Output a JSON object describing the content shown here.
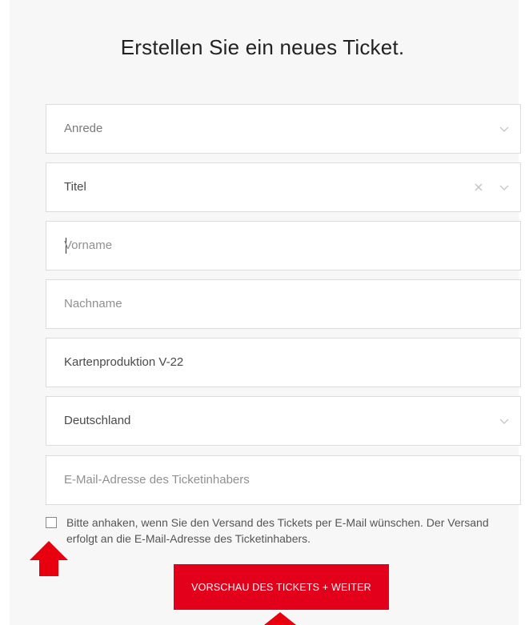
{
  "form": {
    "title": "Erstellen Sie ein neues Ticket.",
    "salutation": {
      "placeholder": "Anrede"
    },
    "academic_title": {
      "value": "Titel"
    },
    "first_name": {
      "placeholder": "Vorname"
    },
    "last_name": {
      "placeholder": "Nachname"
    },
    "card_production": {
      "value": "Kartenproduktion V-22"
    },
    "country": {
      "value": "Deutschland"
    },
    "email": {
      "placeholder": "E-Mail-Adresse des Ticketinhabers"
    },
    "email_consent": {
      "checked": false,
      "label": "Bitte anhaken, wenn Sie den Versand des Tickets per E-Mail wünschen. Der Versand erfolgt an die E-Mail-Adresse des Ticketinhabers."
    },
    "submit_label": "VORSCHAU DES TICKETS + WEITER"
  },
  "annotations": {
    "arrow_color": "#e8000e"
  },
  "colors": {
    "accent": "#e2001a",
    "panel_bg": "#f7f7f7",
    "field_border": "#dcdcdc"
  }
}
